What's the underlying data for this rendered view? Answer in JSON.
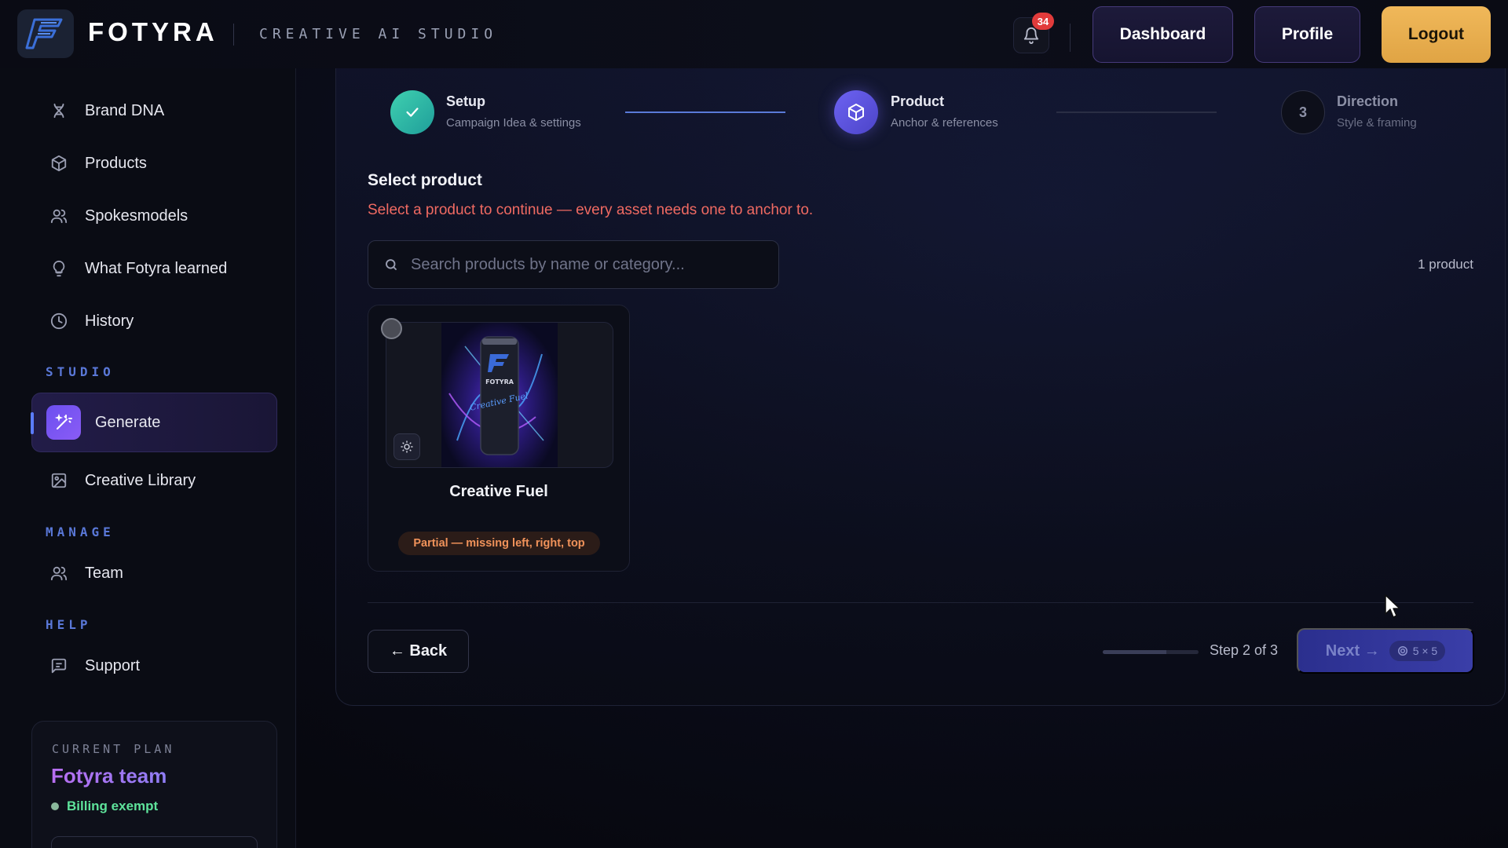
{
  "header": {
    "brand_name": "FOTYRA",
    "brand_tagline": "CREATIVE AI STUDIO",
    "notification_count": "34",
    "dashboard_label": "Dashboard",
    "profile_label": "Profile",
    "logout_label": "Logout"
  },
  "sidebar": {
    "items": [
      {
        "label": "Brand DNA",
        "icon": "dna-icon"
      },
      {
        "label": "Products",
        "icon": "box-icon"
      },
      {
        "label": "Spokesmodels",
        "icon": "people-icon"
      },
      {
        "label": "What Fotyra learned",
        "icon": "lightbulb-icon"
      },
      {
        "label": "History",
        "icon": "clock-icon"
      }
    ],
    "section_studio": "STUDIO",
    "generate_label": "Generate",
    "creative_library_label": "Creative Library",
    "section_manage": "MANAGE",
    "team_label": "Team",
    "section_help": "HELP",
    "support_label": "Support",
    "plan": {
      "label": "CURRENT PLAN",
      "name": "Fotyra team",
      "status": "Billing exempt"
    }
  },
  "stepper": {
    "steps": [
      {
        "title": "Setup",
        "subtitle": "Campaign Idea & settings",
        "state": "done"
      },
      {
        "title": "Product",
        "subtitle": "Anchor & references",
        "state": "active"
      },
      {
        "number": "3",
        "title": "Direction",
        "subtitle": "Style & framing",
        "state": "pending"
      }
    ]
  },
  "main": {
    "section_title": "Select product",
    "warning": "Select a product to continue — every asset needs one to anchor to.",
    "search_placeholder": "Search products by name or category...",
    "product_count": "1 product",
    "products": [
      {
        "name": "Creative Fuel",
        "can_brand": "FOTYRA",
        "can_text": "Creative Fuel",
        "status": "Partial — missing left, right, top"
      }
    ]
  },
  "footer": {
    "back_label": "← Back",
    "step_text": "Step 2 of 3",
    "progress": 0.667,
    "next_label": "Next →",
    "credits": "5 × 5"
  },
  "colors": {
    "accent": "#5b7cff",
    "logout": "#e8ac4c",
    "warning": "#f06a62",
    "success": "#5ee39b"
  }
}
